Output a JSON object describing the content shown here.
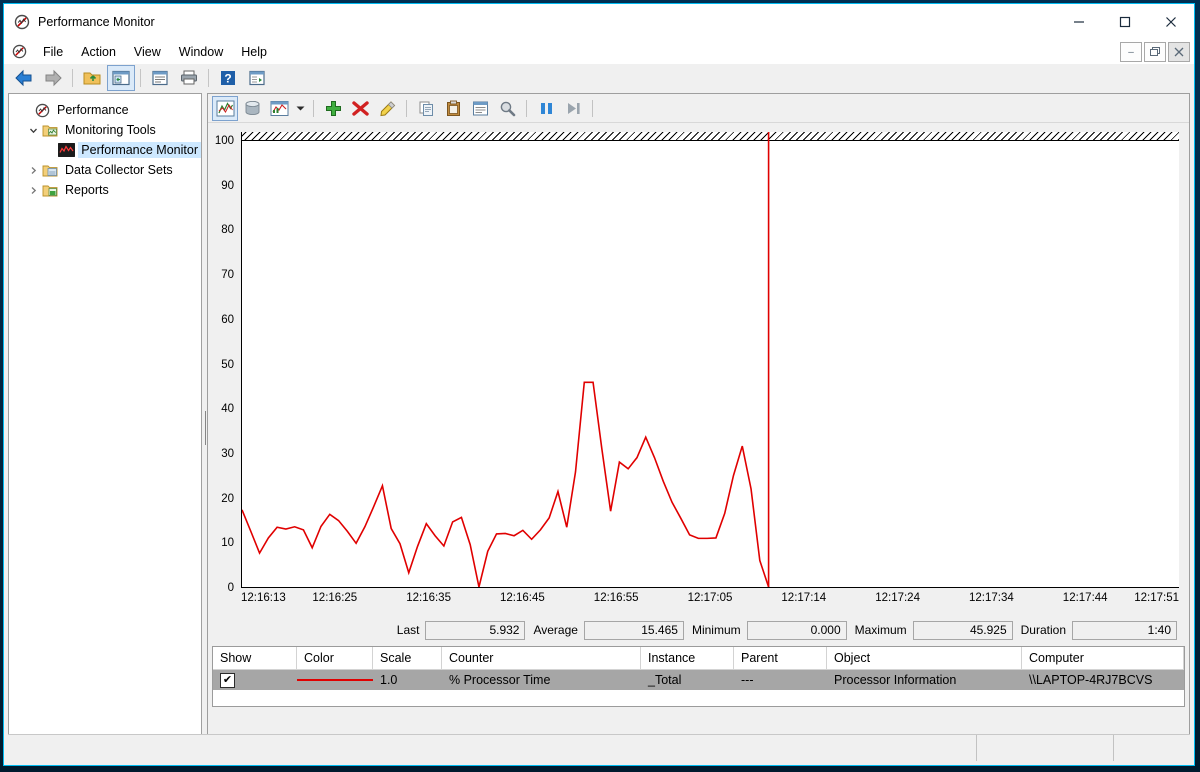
{
  "window": {
    "title": "Performance Monitor",
    "app_icon": "perfmon-icon",
    "controls": {
      "minimize": "—",
      "maximize": "☐",
      "close": "✕"
    },
    "mdi_controls": {
      "minimize": "–",
      "restore": "❐",
      "close": "✕"
    }
  },
  "menubar": {
    "items": [
      {
        "label": "File"
      },
      {
        "label": "Action"
      },
      {
        "label": "View"
      },
      {
        "label": "Window"
      },
      {
        "label": "Help"
      }
    ]
  },
  "toolbar": {
    "items": [
      {
        "name": "back-button",
        "icon": "arrow-left-icon",
        "selected": false
      },
      {
        "name": "forward-button",
        "icon": "arrow-right-icon",
        "selected": false
      },
      {
        "name": "up-one-level-button",
        "icon": "folder-up-icon",
        "selected": false
      },
      {
        "name": "show-hide-console-tree-button",
        "icon": "console-tree-icon",
        "selected": true
      },
      {
        "name": "properties-button",
        "icon": "properties-icon",
        "selected": false
      },
      {
        "name": "print-button",
        "icon": "printer-icon",
        "selected": false
      },
      {
        "name": "help-button",
        "icon": "help-question-icon",
        "selected": false
      },
      {
        "name": "export-list-button",
        "icon": "export-list-icon",
        "selected": false
      }
    ]
  },
  "tree": {
    "nodes": [
      {
        "label": "Performance",
        "icon": "perfmon-icon",
        "arrow": "",
        "indent": 0,
        "selected": false
      },
      {
        "label": "Monitoring Tools",
        "icon": "monitoring-tools-folder-icon",
        "arrow": "⌄",
        "indent": 1,
        "selected": false
      },
      {
        "label": "Performance Monitor",
        "icon": "performance-monitor-icon",
        "arrow": "",
        "indent": 2,
        "selected": true
      },
      {
        "label": "Data Collector Sets",
        "icon": "data-collector-folder-icon",
        "arrow": "›",
        "indent": 1,
        "selected": false
      },
      {
        "label": "Reports",
        "icon": "reports-folder-icon",
        "arrow": "›",
        "indent": 1,
        "selected": false
      }
    ]
  },
  "graph_toolbar": {
    "items": [
      {
        "name": "view-graph-button",
        "icon": "line-graph-icon",
        "selected": true
      },
      {
        "name": "view-3d-button",
        "icon": "cylinder-3d-icon",
        "selected": false
      },
      {
        "name": "change-graph-type-button",
        "icon": "graph-type-icon",
        "selected": false
      },
      {
        "name": "graph-type-dropdown",
        "icon": "chevron-down-icon",
        "selected": false
      },
      {
        "name": "add-counter-button",
        "icon": "plus-icon",
        "selected": false
      },
      {
        "name": "delete-counter-button",
        "icon": "red-x-icon",
        "selected": false
      },
      {
        "name": "highlight-button",
        "icon": "highlighter-pencil-icon",
        "selected": false
      },
      {
        "name": "copy-properties-button",
        "icon": "copy-icon",
        "selected": false
      },
      {
        "name": "paste-counter-list-button",
        "icon": "clipboard-paste-icon",
        "selected": false
      },
      {
        "name": "properties-button",
        "icon": "properties-icon",
        "selected": false
      },
      {
        "name": "zoom-button",
        "icon": "magnifier-icon",
        "selected": false
      },
      {
        "name": "freeze-display-button",
        "icon": "pause-icon",
        "selected": false
      },
      {
        "name": "update-data-button",
        "icon": "step-forward-icon",
        "selected": false
      }
    ]
  },
  "chart_data": {
    "type": "line",
    "title": "",
    "xlabel": "",
    "ylabel": "",
    "ylim": [
      0,
      100
    ],
    "y_ticks": [
      100,
      90,
      80,
      70,
      60,
      50,
      40,
      30,
      20,
      10,
      0
    ],
    "y_tick_labels": [
      "100",
      "90",
      "80",
      "70",
      "60",
      "50",
      "40",
      "30",
      "20",
      "10",
      "0"
    ],
    "x_tick_labels": [
      "12:16:13",
      "12:16:25",
      "12:16:35",
      "12:16:45",
      "12:16:55",
      "12:17:05",
      "12:17:14",
      "12:17:24",
      "12:17:34",
      "12:17:44",
      "12:17:51"
    ],
    "grid": false,
    "legend_position": "bottom-table",
    "line_color": "#e00000",
    "cursor_position_fraction": 0.562,
    "series": [
      {
        "name": "% Processor Time",
        "color": "#e00000",
        "values": [
          17.3,
          12.5,
          7.6,
          11.0,
          13.4,
          13.0,
          13.5,
          12.8,
          8.8,
          13.6,
          16.3,
          14.9,
          12.5,
          9.8,
          13.5,
          18.0,
          22.7,
          13.1,
          9.7,
          3.2,
          9.1,
          14.2,
          11.5,
          9.2,
          14.6,
          15.6,
          9.5,
          0.0,
          8.0,
          11.9,
          12.0,
          11.5,
          12.7,
          10.7,
          12.8,
          15.5,
          21.4,
          13.4,
          25.8,
          45.9,
          45.9,
          31.0,
          17.0,
          28.0,
          26.5,
          29.0,
          33.6,
          29.0,
          23.7,
          19.0,
          15.4,
          11.7,
          10.9,
          10.9,
          11.0,
          16.5,
          25.0,
          31.6,
          22.0,
          5.932,
          0.0
        ]
      }
    ]
  },
  "stats": [
    {
      "label": "Last",
      "value": "5.932"
    },
    {
      "label": "Average",
      "value": "15.465"
    },
    {
      "label": "Minimum",
      "value": "0.000"
    },
    {
      "label": "Maximum",
      "value": "45.925"
    },
    {
      "label": "Duration",
      "value": "1:40"
    }
  ],
  "legend": {
    "columns": [
      "Show",
      "Color",
      "Scale",
      "Counter",
      "Instance",
      "Parent",
      "Object",
      "Computer"
    ],
    "rows": [
      {
        "show": true,
        "show_mark": "✔",
        "color": "#e00000",
        "scale": "1.0",
        "counter": "% Processor Time",
        "instance": "_Total",
        "parent": "---",
        "object": "Processor Information",
        "computer": "\\\\LAPTOP-4RJ7BCVS"
      }
    ]
  },
  "statusbar": {
    "pane1": "",
    "pane2": "",
    "pane3": ""
  }
}
